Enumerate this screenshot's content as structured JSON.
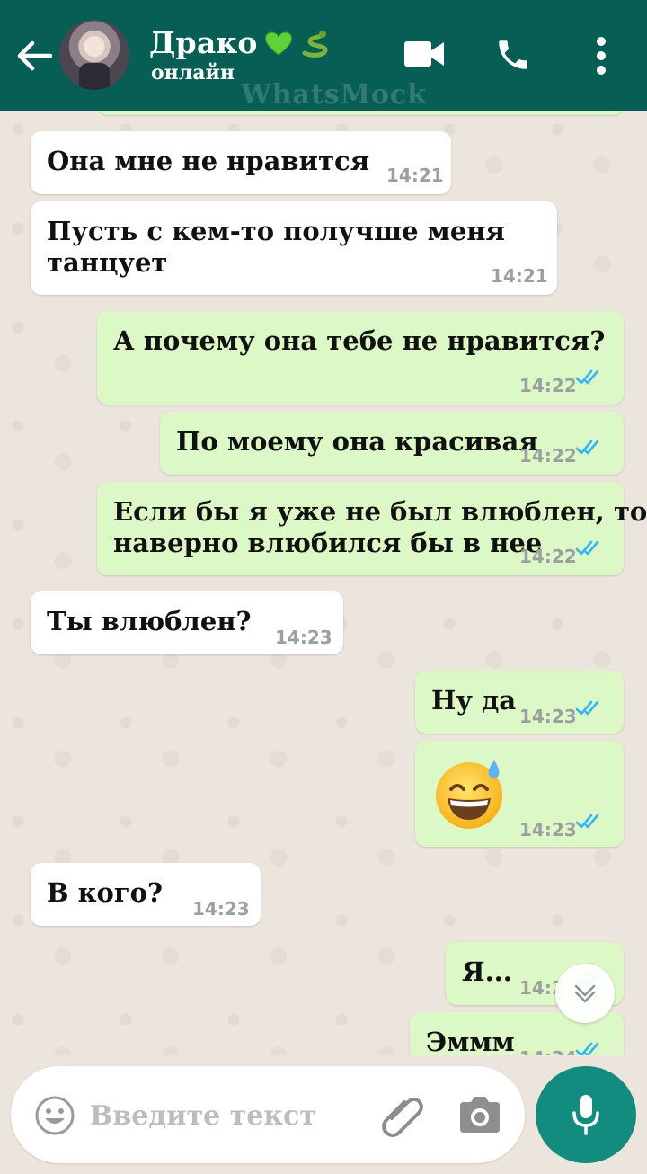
{
  "header": {
    "contact_name": "Драко",
    "status": "онлайн",
    "watermark": "WhatsMock",
    "icons": [
      "back-arrow-icon",
      "green-heart-emoji",
      "snake-emoji",
      "video-call-icon",
      "phone-call-icon",
      "more-vert-icon"
    ]
  },
  "colors": {
    "header": "#075e54",
    "incoming_bubble": "#ffffff",
    "outgoing_bubble": "#dcf8c6",
    "read_ticks": "#34b7f1",
    "mic_button": "#128c7e",
    "chat_background": "#ece5dd"
  },
  "messages": [
    {
      "direction": "in",
      "text": "Она мне не нравится",
      "time": "14:21"
    },
    {
      "direction": "in",
      "text": "Пусть с кем-то получше меня\nтанцует",
      "time": "14:21"
    },
    {
      "direction": "out",
      "text": "А почему она тебе не нравится?",
      "time": "14:22",
      "status": "read"
    },
    {
      "direction": "out",
      "text": "По моему она красивая",
      "time": "14:22",
      "status": "read"
    },
    {
      "direction": "out",
      "text": "Если бы я уже не был влюблен, то\nнаверно влюбился бы в нее",
      "time": "14:22",
      "status": "read"
    },
    {
      "direction": "in",
      "text": "Ты влюблен?",
      "time": "14:23"
    },
    {
      "direction": "out",
      "text": "Ну да",
      "time": "14:23",
      "status": "read"
    },
    {
      "direction": "out",
      "emoji": "grinning-face-with-sweat",
      "time": "14:23",
      "status": "read"
    },
    {
      "direction": "in",
      "text": "В кого?",
      "time": "14:23"
    },
    {
      "direction": "out",
      "text": "Я...",
      "time": "14:2",
      "status": "read"
    },
    {
      "direction": "out",
      "text": "Эммм",
      "time": "14:24",
      "status": "read"
    }
  ],
  "input": {
    "placeholder": "Введите текст",
    "icons": [
      "emoji-icon",
      "attach-icon",
      "camera-icon",
      "mic-icon"
    ]
  },
  "scroll_button_icon": "double-chevron-down-icon"
}
